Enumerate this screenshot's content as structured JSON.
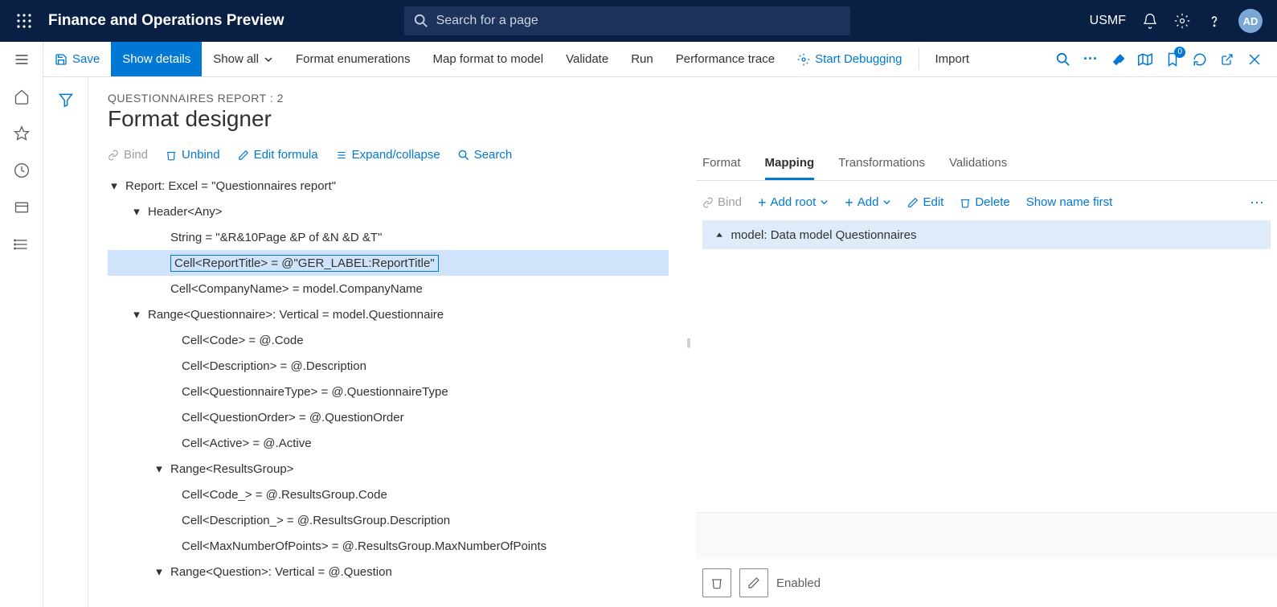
{
  "topbar": {
    "brand": "Finance and Operations Preview",
    "search_placeholder": "Search for a page",
    "entity": "USMF",
    "avatar": "AD"
  },
  "actionbar": {
    "save": "Save",
    "show_details": "Show details",
    "show_all": "Show all",
    "format_enum": "Format enumerations",
    "map_model": "Map format to model",
    "validate": "Validate",
    "run": "Run",
    "perf": "Performance trace",
    "debug": "Start Debugging",
    "import": "Import",
    "badge": "0"
  },
  "page": {
    "crumb": "QUESTIONNAIRES REPORT : 2",
    "title": "Format designer"
  },
  "tree_toolbar": {
    "bind": "Bind",
    "unbind": "Unbind",
    "edit_formula": "Edit formula",
    "expand": "Expand/collapse",
    "search": "Search"
  },
  "tree": [
    {
      "indent": 0,
      "caret": true,
      "text": "Report: Excel = \"Questionnaires report\""
    },
    {
      "indent": 1,
      "caret": true,
      "text": "Header<Any>"
    },
    {
      "indent": 2,
      "caret": false,
      "text": "String = \"&R&10Page &P of &N &D &T\""
    },
    {
      "indent": 2,
      "caret": false,
      "text": "Cell<ReportTitle> = @\"GER_LABEL:ReportTitle\"",
      "selected": true
    },
    {
      "indent": 2,
      "caret": false,
      "text": "Cell<CompanyName> = model.CompanyName"
    },
    {
      "indent": 1,
      "caret": true,
      "text": "Range<Questionnaire>: Vertical = model.Questionnaire"
    },
    {
      "indent": 3,
      "caret": false,
      "text": "Cell<Code> = @.Code"
    },
    {
      "indent": 3,
      "caret": false,
      "text": "Cell<Description> = @.Description"
    },
    {
      "indent": 3,
      "caret": false,
      "text": "Cell<QuestionnaireType> = @.QuestionnaireType"
    },
    {
      "indent": 3,
      "caret": false,
      "text": "Cell<QuestionOrder> = @.QuestionOrder"
    },
    {
      "indent": 3,
      "caret": false,
      "text": "Cell<Active> = @.Active"
    },
    {
      "indent": 2,
      "caret": true,
      "text": "Range<ResultsGroup>"
    },
    {
      "indent": 3,
      "caret": false,
      "text": "Cell<Code_> = @.ResultsGroup.Code"
    },
    {
      "indent": 3,
      "caret": false,
      "text": "Cell<Description_> = @.ResultsGroup.Description"
    },
    {
      "indent": 3,
      "caret": false,
      "text": "Cell<MaxNumberOfPoints> = @.ResultsGroup.MaxNumberOfPoints"
    },
    {
      "indent": 2,
      "caret": true,
      "text": "Range<Question>: Vertical = @.Question"
    }
  ],
  "map_tabs": {
    "format": "Format",
    "mapping": "Mapping",
    "trans": "Transformations",
    "valid": "Validations"
  },
  "map_toolbar": {
    "bind": "Bind",
    "add_root": "Add root",
    "add": "Add",
    "edit": "Edit",
    "delete": "Delete",
    "show_name": "Show name first"
  },
  "map_model": "model: Data model Questionnaires",
  "footer": {
    "enabled": "Enabled"
  }
}
